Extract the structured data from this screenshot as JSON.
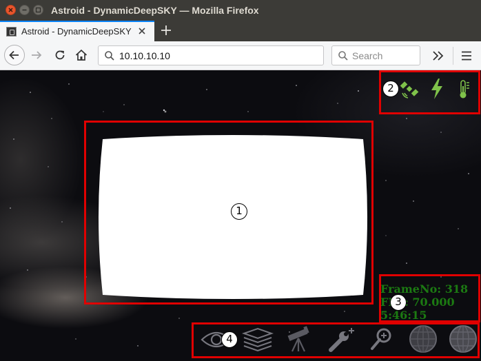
{
  "window": {
    "title": "Astroid - DynamicDeepSKY — Mozilla Firefox"
  },
  "tabs": [
    {
      "label": "Astroid - DynamicDeepSKY",
      "active": true
    }
  ],
  "navigation": {
    "url": "10.10.10.10",
    "search_placeholder": "Search"
  },
  "page": {
    "callouts": [
      "1",
      "2",
      "3",
      "4"
    ],
    "status_icons": [
      "satellite-icon",
      "lightning-icon",
      "thermometer-icon"
    ],
    "status_icon_color": "#7fc24a",
    "readout": {
      "line1": "FrameNo: 318",
      "line2": "FPS: 70.000",
      "line3": "5:46:15",
      "color": "#1c7a12"
    },
    "toolbar_icons": [
      "eye-icon",
      "layers-icon",
      "telescope-icon",
      "wrench-icon",
      "zoom-icon",
      "globe-grid-icon",
      "globe-icon"
    ]
  },
  "colors": {
    "highlight_border": "#e00000",
    "tab_accent": "#0a84ff",
    "titlebar": "#3c3b37"
  }
}
